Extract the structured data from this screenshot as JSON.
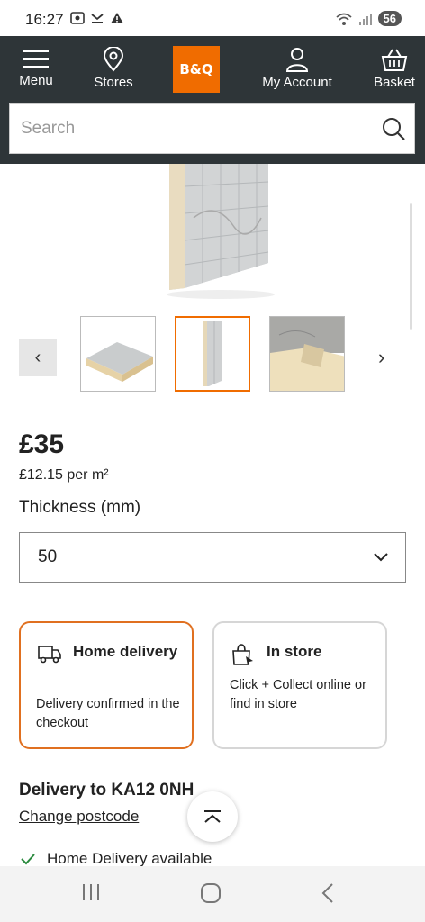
{
  "status_bar": {
    "time": "16:27",
    "battery": "56"
  },
  "header": {
    "logo": "B&Q",
    "nav": {
      "menu": "Menu",
      "stores": "Stores",
      "account": "My Account",
      "basket": "Basket"
    },
    "search_placeholder": "Search"
  },
  "gallery": {
    "prev_label": "‹",
    "next_label": "›"
  },
  "product": {
    "price": "£35",
    "price_per_m2": "£12.15 per m²",
    "thickness_label": "Thickness (mm)",
    "thickness_value": "50"
  },
  "fulfilment": {
    "home": {
      "title": "Home delivery",
      "description": "Delivery confirmed in the checkout"
    },
    "store": {
      "title": "In store",
      "description": "Click + Collect online or find in store"
    }
  },
  "delivery": {
    "heading": "Delivery to KA12 0NH",
    "change_link": "Change postcode",
    "availability": "Home Delivery available"
  },
  "colors": {
    "brand": "#f06c00",
    "header_bg": "#2e3538",
    "available_green": "#2a8a3e"
  }
}
